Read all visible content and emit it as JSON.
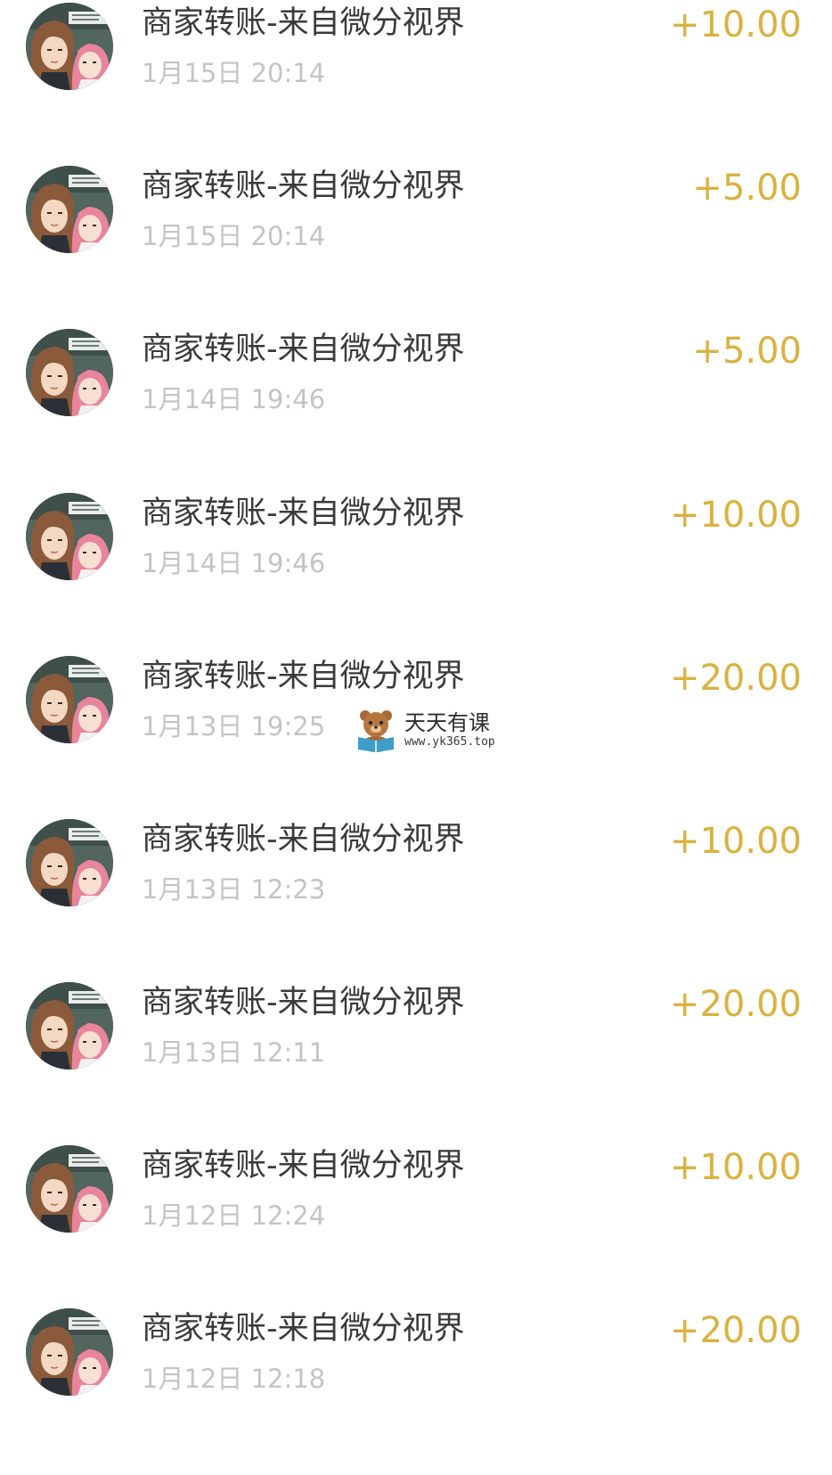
{
  "transactions": [
    {
      "title": "商家转账-来自微分视界",
      "time": "1月15日 20:14",
      "amount": "+10.00"
    },
    {
      "title": "商家转账-来自微分视界",
      "time": "1月15日 20:14",
      "amount": "+5.00"
    },
    {
      "title": "商家转账-来自微分视界",
      "time": "1月14日 19:46",
      "amount": "+5.00"
    },
    {
      "title": "商家转账-来自微分视界",
      "time": "1月14日 19:46",
      "amount": "+10.00"
    },
    {
      "title": "商家转账-来自微分视界",
      "time": "1月13日 19:25",
      "amount": "+20.00"
    },
    {
      "title": "商家转账-来自微分视界",
      "time": "1月13日 12:23",
      "amount": "+10.00"
    },
    {
      "title": "商家转账-来自微分视界",
      "time": "1月13日 12:11",
      "amount": "+20.00"
    },
    {
      "title": "商家转账-来自微分视界",
      "time": "1月12日 12:24",
      "amount": "+10.00"
    },
    {
      "title": "商家转账-来自微分视界",
      "time": "1月12日 12:18",
      "amount": "+20.00"
    }
  ],
  "watermark": {
    "title": "天天有课",
    "url": "www.yk365.top"
  },
  "colors": {
    "amount": "#d9b23f",
    "title": "#3a3a3a",
    "time": "#c4c4c4"
  },
  "avatar_icon": "merchant-avatar-icon"
}
